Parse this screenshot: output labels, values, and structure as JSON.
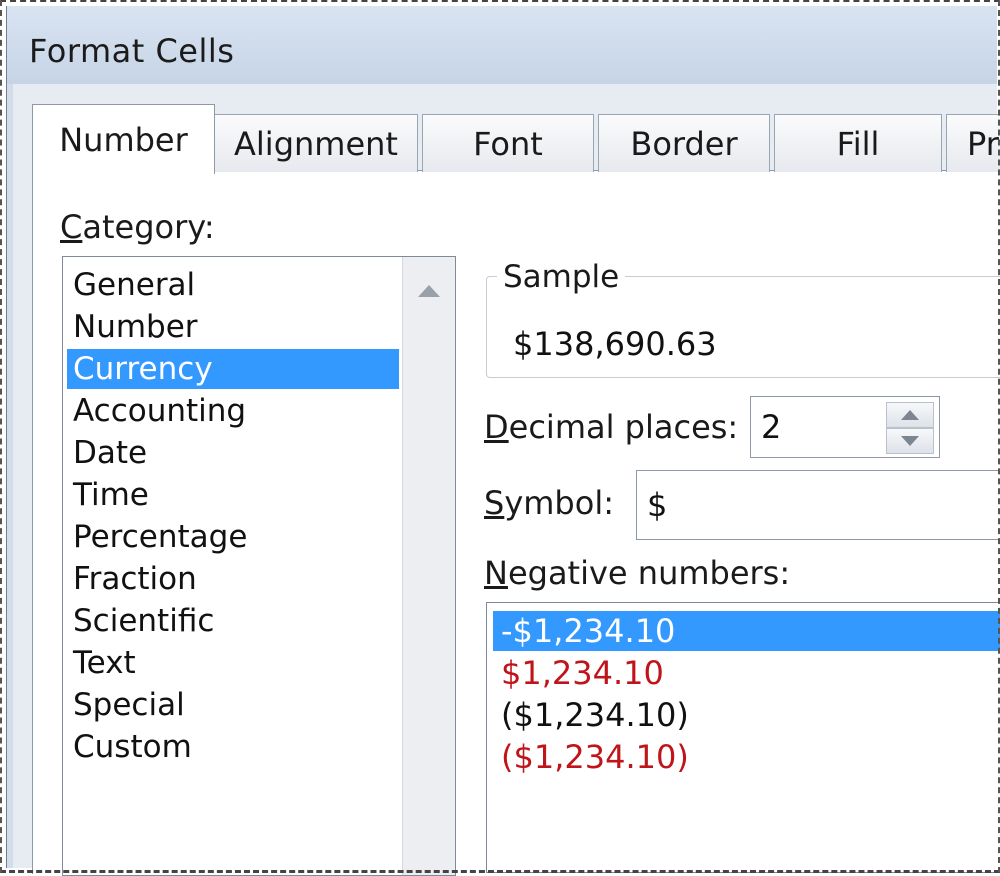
{
  "window": {
    "title": "Format Cells"
  },
  "tabs": [
    {
      "label": "Number",
      "active": true
    },
    {
      "label": "Alignment",
      "active": false
    },
    {
      "label": "Font",
      "active": false
    },
    {
      "label": "Border",
      "active": false
    },
    {
      "label": "Fill",
      "active": false
    },
    {
      "label": "Pr",
      "active": false
    }
  ],
  "category": {
    "label_mnemonic": "C",
    "label_rest": "ategory:",
    "items": [
      "General",
      "Number",
      "Currency",
      "Accounting",
      "Date",
      "Time",
      "Percentage",
      "Fraction",
      "Scientific",
      "Text",
      "Special",
      "Custom"
    ],
    "selected": "Currency"
  },
  "sample": {
    "title": "Sample",
    "value": "$138,690.63"
  },
  "decimal_places": {
    "label_mnemonic": "D",
    "label_rest": "ecimal places:",
    "value": "2"
  },
  "symbol": {
    "label_mnemonic": "S",
    "label_rest": "ymbol:",
    "value": "$"
  },
  "negative_numbers": {
    "label_mnemonic": "N",
    "label_rest": "egative numbers:",
    "items": [
      {
        "text": "-$1,234.10",
        "color": "#ffffff",
        "selected": true
      },
      {
        "text": "$1,234.10",
        "color": "#c0141b",
        "selected": false
      },
      {
        "text": "($1,234.10)",
        "color": "#111111",
        "selected": false
      },
      {
        "text": "($1,234.10)",
        "color": "#c0141b",
        "selected": false
      }
    ]
  },
  "colors": {
    "selection": "#3399ff",
    "negative_red": "#c0141b"
  },
  "icons": {
    "scroll_up": "triangle-up-icon",
    "spin_up": "spin-up-icon",
    "spin_down": "spin-down-icon"
  }
}
